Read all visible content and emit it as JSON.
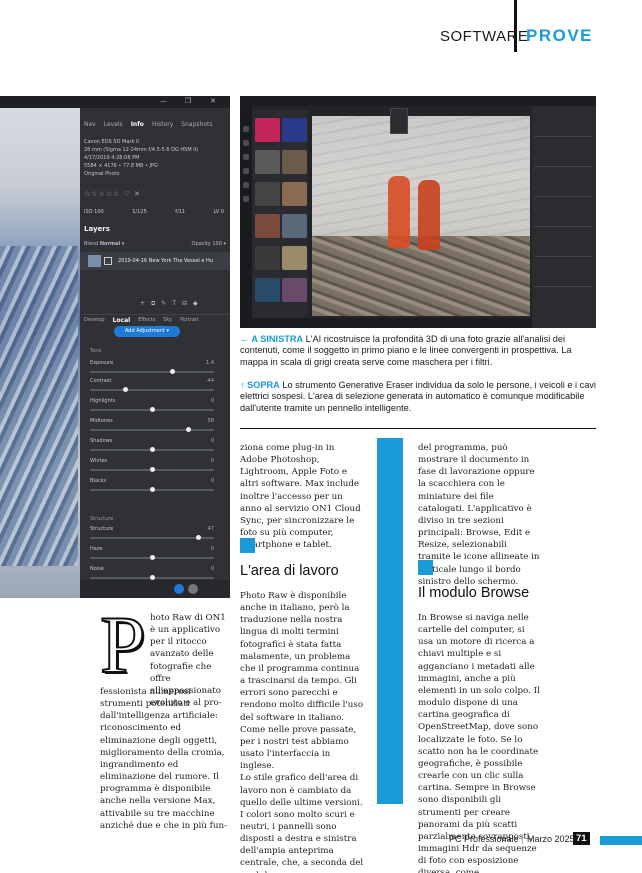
{
  "header": {
    "section": "SOFTWARE",
    "category": "PROVE"
  },
  "screenshot_left": {
    "panel_tabs": [
      "Nav",
      "Levels",
      "Info",
      "History",
      "Snapshots"
    ],
    "active_tab": "Info",
    "meta_lines": [
      "Canon EOS 5D Mark II",
      "28 mm (Sigma 12-24mm f/4.5-5.6 DG HSM II)",
      "4/17/2019 4:28:08 PM",
      "5584 × 4176 • 77.8 MB • JPG",
      "Original Photo"
    ],
    "exif": [
      "ISO 100",
      "1/125",
      "f/11",
      "LV 0"
    ],
    "layers_title": "Layers",
    "blend_label": "Blend",
    "blend_value": "Normal",
    "opacity_label": "Opacity",
    "opacity_value": "100",
    "layer_name": "2019-04-16 New York The Vessel e Hu",
    "module_tabs": [
      "Develop",
      "Local",
      "Effects",
      "Sky",
      "Portrait"
    ],
    "active_module": "Local",
    "add_adjustment": "Add Adjustment",
    "tone_section": "Tone",
    "structure_section": "Structure",
    "sliders": [
      {
        "label": "Exposure",
        "value": "1.4",
        "level": 0.66
      },
      {
        "label": "Contrast",
        "value": "-44",
        "level": 0.28
      },
      {
        "label": "Highlights",
        "value": "0",
        "level": 0.5
      },
      {
        "label": "Midtones",
        "value": "58",
        "level": 0.79
      },
      {
        "label": "Shadows",
        "value": "0",
        "level": 0.5
      },
      {
        "label": "Whites",
        "value": "0",
        "level": 0.5
      },
      {
        "label": "Blacks",
        "value": "0",
        "level": 0.5
      },
      {
        "label": "Structure",
        "value": "47",
        "level": 0.87
      },
      {
        "label": "Haze",
        "value": "0",
        "level": 0.5
      },
      {
        "label": "Noise",
        "value": "0",
        "level": 0.5
      }
    ]
  },
  "captions": {
    "left_tag": "← A SINISTRA",
    "left_text": " L'AI ricostruisce la profondità 3D di una foto grazie all'analisi dei contenuti, come il soggetto in primo piano e le linee convergenti in prospettiva. La mappa in scala di grigi creata serve come maschera per i filtri.",
    "up_tag": "↑ SOPRA",
    "up_text": " Lo strumento Generative Eraser individua da solo le persone, i veicoli e i cavi elettrici sospesi. L'area di selezione generata in automatico è comunque modificabile dall'utente tramite un pennello intelligente."
  },
  "article": {
    "dropcap": "P",
    "col1_intro": "hoto Raw di ON1 è un applicativo per il ritocco avanzato delle fotografie che offre all'appassionato evoluto e al pro-",
    "col1_body": "fessionista numerosi strumenti potenziati dall'intelligenza artificiale: riconoscimento ed eliminazione degli oggetti, miglioramento della cromia, ingrandimento ed eliminazione del rumore. Il programma è disponibile anche nella versione Max, attivabile su tre macchine anziché due e che in più fun-",
    "col2_top": "ziona come plug-in in Adobe Photoshop, Lightroom, Apple Foto e altri software. Max include inoltre l'accesso per un anno al servizio ON1 Cloud Sync, per sincronizzare le foto su più computer, smartphone e tablet.",
    "h_area": "L'area di lavoro",
    "col2_body": "Photo Raw è disponibile anche in italiano, però la traduzione nella nostra lingua di molti termini fotografici è stata fatta malamente, un problema che il programma continua a trascinarsi da tempo. Gli errori sono parecchi e rendono molto difficile l'uso del software in italiano. Come nelle prove passate, per i nostri test abbiamo usato l'interfaccia in inglese.\nLo stile grafico dell'area di lavoro non è cambiato da quello delle ultime versioni. I colori sono molto scuri e neutri, i pannelli sono disposti a destra e sinistra dell'ampia anteprima centrale, che, a seconda del modulo",
    "col3_top": "del programma, può mostrare il documento in fase di lavorazione oppure la scacchiera con le miniature dei file catalogati. L'applicativo è diviso in tre sezioni principali: Browse, Edit e Resize, selezionabili tramite le icone allineate in verticale lungo il bordo sinistro dello schermo.",
    "h_browse": "Il modulo Browse",
    "col3_body": "In Browse si naviga nelle cartelle del computer, si usa un motore di ricerca a chiavi multiple e si agganciano i metadati alle immagini, anche a più elementi in un solo colpo. Il modulo dispone di una cartina geografica di OpenStreetMap, dove sono localizzate le foto. Se lo scatto non ha le coordinate geografiche, è possibile crearle con un clic sulla cartina. Sempre in Browse sono disponibili gli strumenti per creare panorami da più scatti parzialmente sovrapposti, immagini Hdr da sequenze di foto con esposizione diversa, come"
  },
  "footer": {
    "magazine": "PC Professionale",
    "separator": "|",
    "date": "Marzo 2025",
    "page": "71"
  },
  "colors": {
    "accent": "#1a9ad6",
    "ui_dark": "#2f3135"
  }
}
